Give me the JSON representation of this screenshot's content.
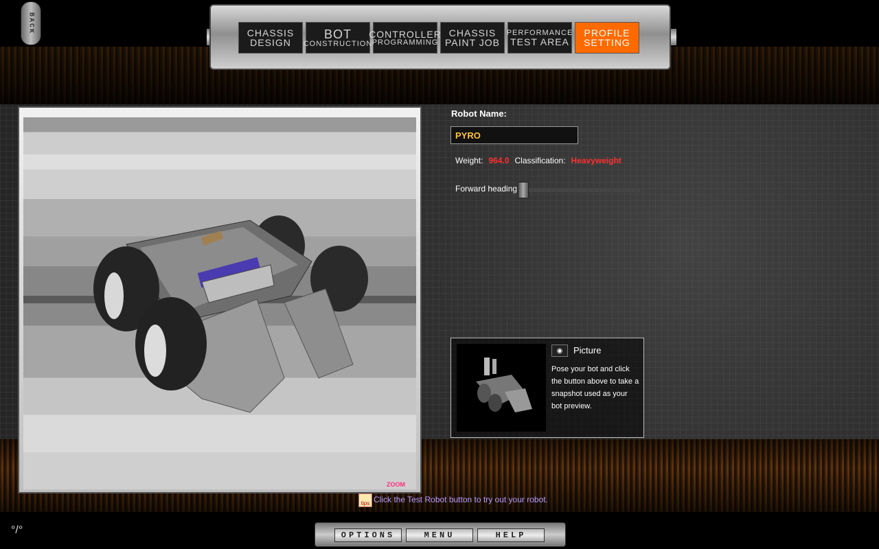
{
  "back_label": "BACK",
  "tabs": [
    {
      "line1": "CHASSIS",
      "line2": "DESIGN",
      "active": false
    },
    {
      "line1": "BOT",
      "line2": "CONSTRUCTION",
      "active": false
    },
    {
      "line1": "CONTROLLER",
      "line2": "PROGRAMMING",
      "active": false
    },
    {
      "line1": "CHASSIS",
      "line2": "PAINT JOB",
      "active": false
    },
    {
      "line1": "PERFORMANCE",
      "line2": "TEST AREA",
      "active": false
    },
    {
      "line1": "PROFILE",
      "line2": "SETTING",
      "active": true
    }
  ],
  "preview": {
    "zoom_label": "ZOOM"
  },
  "robot": {
    "name_label": "Robot Name:",
    "name_value": "PYRO",
    "weight_label": "Weight:",
    "weight_value": "964.0",
    "class_label": "Classification:",
    "class_value": "Heavyweight",
    "heading_label": "Forward heading:"
  },
  "picture": {
    "title": "Picture",
    "description": "Pose your bot and click the button above to take a snapshot used as your bot preview."
  },
  "tip": {
    "icon_text": "tips",
    "text": "Click the Test Robot button to try out your robot."
  },
  "bottom_menu": {
    "options": "OPTIONS",
    "menu": "MENU",
    "help": "HELP"
  },
  "colors": {
    "active_tab": "#ff6a00",
    "name_text": "#ffc23a",
    "red_value": "#ff3030",
    "tip_text": "#b59bff"
  }
}
